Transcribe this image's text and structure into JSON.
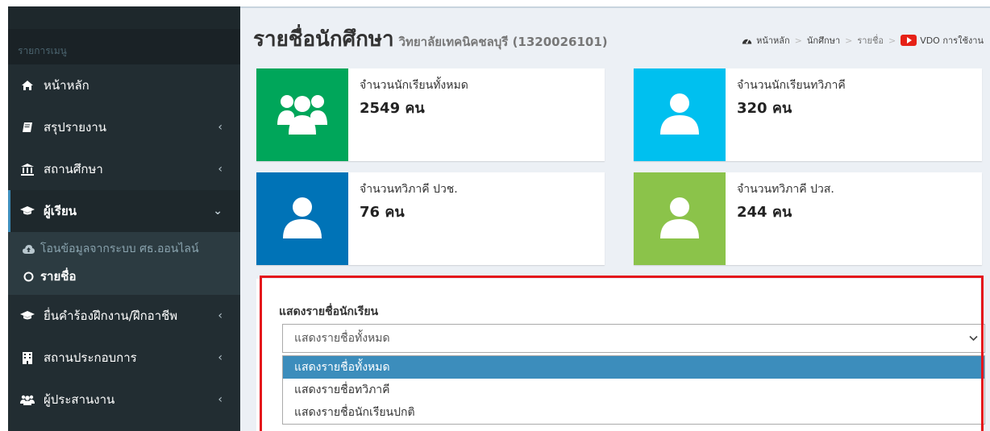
{
  "sidebar": {
    "header": "รายการเมนู",
    "items": [
      {
        "label": "หน้าหลัก",
        "icon": "home-icon"
      },
      {
        "label": "สรุปรายงาน",
        "icon": "book-icon"
      },
      {
        "label": "สถานศึกษา",
        "icon": "bank-icon"
      },
      {
        "label": "ผู้เรียน",
        "icon": "graduation-cap-icon"
      },
      {
        "label": "ยื่นคำร้องฝึกงาน/ฝึกอาชีพ",
        "icon": "graduation-cap-icon"
      },
      {
        "label": "สถานประกอบการ",
        "icon": "building-icon"
      },
      {
        "label": "ผู้ประสานงาน",
        "icon": "users-icon"
      }
    ],
    "submenu": [
      {
        "label": "โอนข้อมูลจากระบบ ศธ.ออนไลน์",
        "icon": "cloud-upload-icon"
      },
      {
        "label": "รายชื่อ",
        "icon": "circle-icon"
      }
    ]
  },
  "header": {
    "title": "รายชื่อนักศึกษา",
    "subtitle": "วิทยาลัยเทคนิคชลบุรี (1320026101)"
  },
  "breadcrumb": {
    "home": "หน้าหลัก",
    "students": "นักศึกษา",
    "list": "รายชื่อ",
    "video": "VDO การใช้งาน"
  },
  "stats": [
    {
      "label": "จำนวนนักเรียนทั้งหมด",
      "value": "2549 คน",
      "color": "#00a65a",
      "icon": "users-icon"
    },
    {
      "label": "จำนวนนักเรียนทวิภาคี",
      "value": "320 คน",
      "color": "#00c0ef",
      "icon": "user-icon"
    },
    {
      "label": "จำนวนทวิภาคี ปวช.",
      "value": "76 คน",
      "color": "#0073b7",
      "icon": "user-icon"
    },
    {
      "label": "จำนวนทวิภาคี ปวส.",
      "value": "244 คน",
      "color": "#8bc34a",
      "icon": "user-icon"
    }
  ],
  "filter": {
    "title": "แสดงรายชื่อนักเรียน",
    "selected": "แสดงรายชื่อทั้งหมด",
    "options": [
      "แสดงรายชื่อทั้งหมด",
      "แสดงรายชื่อทวิภาคี",
      "แสดงรายชื่อนักเรียนปกติ"
    ]
  },
  "colors": {
    "sidebar_bg": "#222d32",
    "accent": "#3c8dbc",
    "highlight": "#e4141b"
  }
}
